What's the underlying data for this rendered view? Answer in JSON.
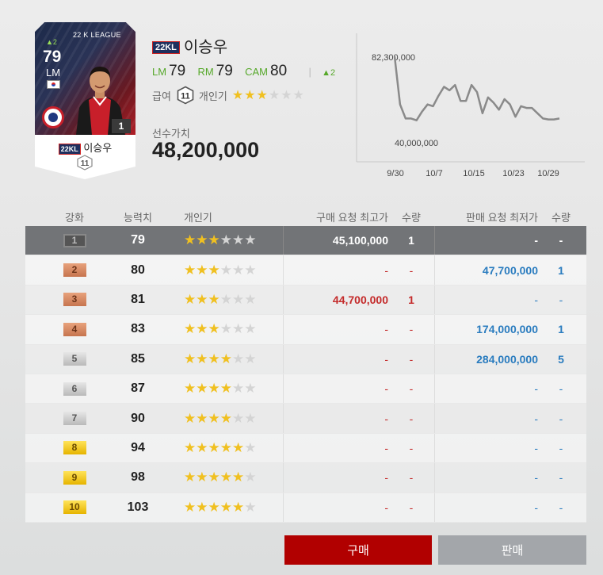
{
  "card": {
    "league": "22 K LEAGUE",
    "ovr_up": "▲2",
    "ovr": "79",
    "position": "LM",
    "level": "1",
    "season_tag": "22KL",
    "name": "이승우",
    "pay": "11"
  },
  "player": {
    "season_tag": "22KL",
    "name": "이승우",
    "ratings": [
      {
        "pos": "LM",
        "value": "79"
      },
      {
        "pos": "RM",
        "value": "79"
      },
      {
        "pos": "CAM",
        "value": "80"
      }
    ],
    "boost": "▲2",
    "pay_label": "급여",
    "pay_value": "11",
    "skill_label": "개인기",
    "skill_stars": 3,
    "value_label": "선수가치",
    "value": "48,200,000"
  },
  "price_chart": {
    "max_label": "82,300,000",
    "min_label": "40,000,000",
    "x_ticks": [
      "9/30",
      "10/7",
      "10/15",
      "10/23",
      "10/29"
    ],
    "ylim": [
      40000000,
      82300000
    ],
    "chart_data": {
      "type": "line",
      "x": [
        "9/30",
        "10/1",
        "10/2",
        "10/3",
        "10/4",
        "10/5",
        "10/6",
        "10/7",
        "10/8",
        "10/9",
        "10/10",
        "10/11",
        "10/12",
        "10/13",
        "10/14",
        "10/15",
        "10/16",
        "10/17",
        "10/18",
        "10/19",
        "10/20",
        "10/21",
        "10/22",
        "10/23",
        "10/24",
        "10/25",
        "10/26",
        "10/27",
        "10/28",
        "10/29",
        "10/30"
      ],
      "values": [
        82300000,
        55000000,
        47000000,
        47000000,
        46000000,
        51000000,
        55000000,
        54000000,
        60000000,
        65000000,
        63000000,
        66000000,
        57000000,
        57000000,
        66000000,
        62000000,
        50000000,
        59000000,
        56000000,
        52000000,
        58000000,
        55000000,
        48000000,
        54000000,
        53000000,
        53000000,
        50000000,
        47000000,
        46500000,
        46500000,
        47000000
      ]
    }
  },
  "table": {
    "headers": {
      "level": "강화",
      "ability": "능력치",
      "skill": "개인기",
      "buy_price": "구매 요청 최고가",
      "buy_qty": "수량",
      "sell_price": "판매 요청 최저가",
      "sell_qty": "수량"
    },
    "rows": [
      {
        "level": "1",
        "badge": "dark",
        "ability": "79",
        "stars": "★★★★★★",
        "stars_on": 3,
        "buy_price": "45,100,000",
        "buy_qty": "1",
        "sell_price": "-",
        "sell_qty": "-"
      },
      {
        "level": "2",
        "badge": "bronze",
        "ability": "80",
        "stars_on": 3,
        "buy_price": "-",
        "buy_qty": "-",
        "sell_price": "47,700,000",
        "sell_qty": "1"
      },
      {
        "level": "3",
        "badge": "bronze",
        "ability": "81",
        "stars_on": 3,
        "buy_price": "44,700,000",
        "buy_qty": "1",
        "sell_price": "-",
        "sell_qty": "-"
      },
      {
        "level": "4",
        "badge": "bronze",
        "ability": "83",
        "stars_on": 3,
        "buy_price": "-",
        "buy_qty": "-",
        "sell_price": "174,000,000",
        "sell_qty": "1"
      },
      {
        "level": "5",
        "badge": "silver",
        "ability": "85",
        "stars_on": 4,
        "buy_price": "-",
        "buy_qty": "-",
        "sell_price": "284,000,000",
        "sell_qty": "5"
      },
      {
        "level": "6",
        "badge": "silver",
        "ability": "87",
        "stars_on": 4,
        "buy_price": "-",
        "buy_qty": "-",
        "sell_price": "-",
        "sell_qty": "-"
      },
      {
        "level": "7",
        "badge": "silver",
        "ability": "90",
        "stars_on": 4,
        "buy_price": "-",
        "buy_qty": "-",
        "sell_price": "-",
        "sell_qty": "-"
      },
      {
        "level": "8",
        "badge": "gold",
        "ability": "94",
        "stars_on": 5,
        "buy_price": "-",
        "buy_qty": "-",
        "sell_price": "-",
        "sell_qty": "-"
      },
      {
        "level": "9",
        "badge": "gold",
        "ability": "98",
        "stars_on": 5,
        "buy_price": "-",
        "buy_qty": "-",
        "sell_price": "-",
        "sell_qty": "-"
      },
      {
        "level": "10",
        "badge": "gold",
        "ability": "103",
        "stars_on": 5,
        "buy_price": "-",
        "buy_qty": "-",
        "sell_price": "-",
        "sell_qty": "-"
      }
    ]
  },
  "buttons": {
    "buy": "구매",
    "sell": "판매"
  },
  "colors": {
    "buy_button": "#b10000",
    "sell_button": "#a3a6aa",
    "buy_price": "#c42a2a",
    "sell_price": "#2a7cbf",
    "position_green": "#56a82a",
    "star": "#f0c020"
  }
}
